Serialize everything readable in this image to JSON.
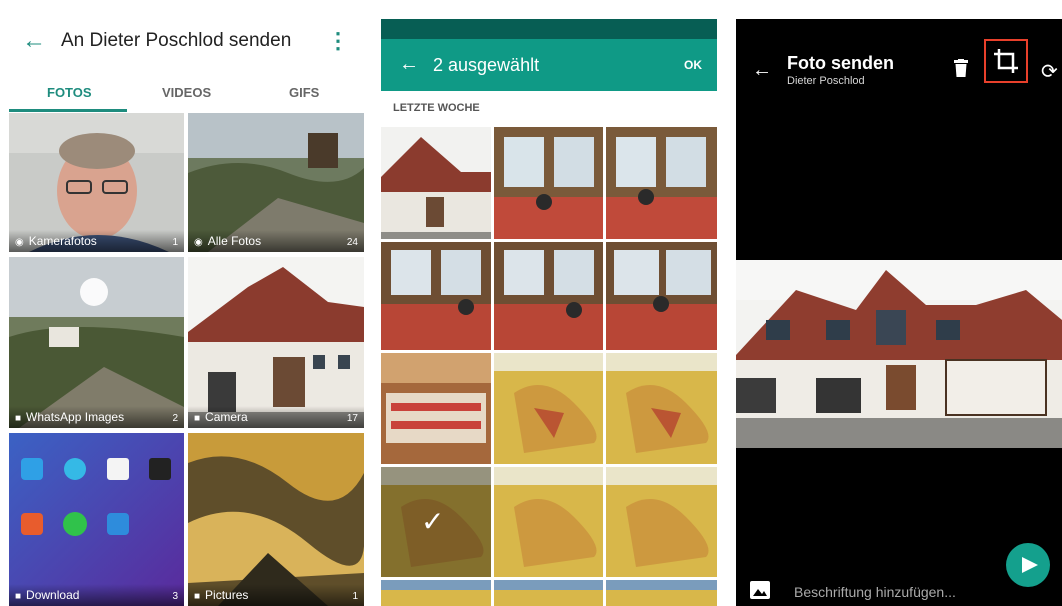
{
  "panel1": {
    "title": "An Dieter Poschlod senden",
    "tabs": [
      {
        "label": "FOTOS",
        "active": true
      },
      {
        "label": "VIDEOS",
        "active": false
      },
      {
        "label": "GIFS",
        "active": false
      }
    ],
    "folders": [
      {
        "label": "Kamerafotos",
        "count": "1",
        "icon": "camera-icon"
      },
      {
        "label": "Alle Fotos",
        "count": "24",
        "icon": "camera-icon"
      },
      {
        "label": "WhatsApp Images",
        "count": "2",
        "icon": "folder-icon"
      },
      {
        "label": "Camera",
        "count": "17",
        "icon": "folder-icon"
      },
      {
        "label": "Download",
        "count": "3",
        "icon": "folder-icon"
      },
      {
        "label": "Pictures",
        "count": "1",
        "icon": "folder-icon"
      }
    ]
  },
  "panel2": {
    "title": "2 ausgewählt",
    "ok_label": "OK",
    "section": "LETZTE WOCHE"
  },
  "panel3": {
    "title": "Foto senden",
    "subtitle": "Dieter Poschlod",
    "caption_placeholder": "Beschriftung hinzufügen..."
  },
  "colors": {
    "accent": "#1e8c7e",
    "appbar": "#0f9a86",
    "statusbar": "#075e54",
    "highlight": "#e8402b"
  }
}
